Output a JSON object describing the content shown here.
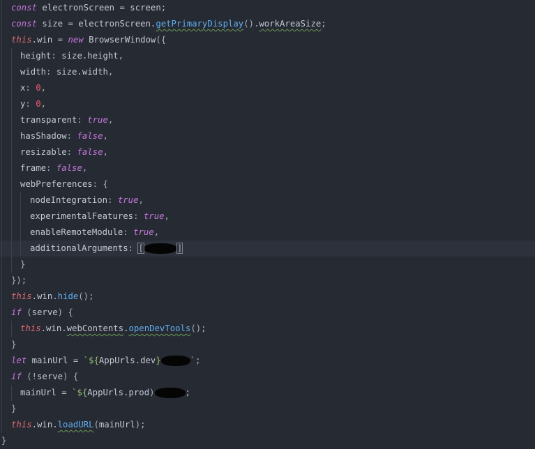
{
  "editor": {
    "lines": [
      {
        "indent": 1,
        "tokens": [
          {
            "t": "const",
            "c": "kw"
          },
          {
            "t": " electronScreen "
          },
          {
            "t": "=",
            "c": "punc"
          },
          {
            "t": " screen"
          },
          {
            "t": ";",
            "c": "punc"
          }
        ]
      },
      {
        "indent": 1,
        "tokens": [
          {
            "t": "const",
            "c": "kw"
          },
          {
            "t": " size "
          },
          {
            "t": "=",
            "c": "punc"
          },
          {
            "t": " electronScreen."
          },
          {
            "t": "getPrimaryDisplay",
            "c": "method",
            "sq": true
          },
          {
            "t": "().",
            "c": "punc"
          },
          {
            "t": "workAreaSize",
            "c": "prop",
            "sq": true
          },
          {
            "t": ";",
            "c": "punc"
          }
        ]
      },
      {
        "indent": 1,
        "tokens": [
          {
            "t": "this",
            "c": "this"
          },
          {
            "t": ".win "
          },
          {
            "t": "=",
            "c": "punc"
          },
          {
            "t": " "
          },
          {
            "t": "new",
            "c": "kw"
          },
          {
            "t": " BrowserWindow"
          },
          {
            "t": "({",
            "c": "punc"
          }
        ]
      },
      {
        "indent": 2,
        "tokens": [
          {
            "t": "height"
          },
          {
            "t": ":",
            "c": "punc"
          },
          {
            "t": " size.height"
          },
          {
            "t": ",",
            "c": "punc"
          }
        ]
      },
      {
        "indent": 2,
        "tokens": [
          {
            "t": "width"
          },
          {
            "t": ":",
            "c": "punc"
          },
          {
            "t": " size.width"
          },
          {
            "t": ",",
            "c": "punc"
          }
        ]
      },
      {
        "indent": 2,
        "tokens": [
          {
            "t": "x"
          },
          {
            "t": ":",
            "c": "punc"
          },
          {
            "t": " "
          },
          {
            "t": "0",
            "c": "num"
          },
          {
            "t": ",",
            "c": "punc"
          }
        ]
      },
      {
        "indent": 2,
        "tokens": [
          {
            "t": "y"
          },
          {
            "t": ":",
            "c": "punc"
          },
          {
            "t": " "
          },
          {
            "t": "0",
            "c": "num"
          },
          {
            "t": ",",
            "c": "punc"
          }
        ]
      },
      {
        "indent": 2,
        "tokens": [
          {
            "t": "transparent"
          },
          {
            "t": ":",
            "c": "punc"
          },
          {
            "t": " "
          },
          {
            "t": "true",
            "c": "kw"
          },
          {
            "t": ",",
            "c": "punc"
          }
        ]
      },
      {
        "indent": 2,
        "tokens": [
          {
            "t": "hasShadow"
          },
          {
            "t": ":",
            "c": "punc"
          },
          {
            "t": " "
          },
          {
            "t": "false",
            "c": "kw"
          },
          {
            "t": ",",
            "c": "punc"
          }
        ]
      },
      {
        "indent": 2,
        "tokens": [
          {
            "t": "resizable"
          },
          {
            "t": ":",
            "c": "punc"
          },
          {
            "t": " "
          },
          {
            "t": "false",
            "c": "kw"
          },
          {
            "t": ",",
            "c": "punc"
          }
        ]
      },
      {
        "indent": 2,
        "tokens": [
          {
            "t": "frame"
          },
          {
            "t": ":",
            "c": "punc"
          },
          {
            "t": " "
          },
          {
            "t": "false",
            "c": "kw"
          },
          {
            "t": ",",
            "c": "punc"
          }
        ]
      },
      {
        "indent": 2,
        "tokens": [
          {
            "t": "webPreferences"
          },
          {
            "t": ":",
            "c": "punc"
          },
          {
            "t": " {",
            "c": "punc"
          }
        ]
      },
      {
        "indent": 3,
        "tokens": [
          {
            "t": "nodeIntegration"
          },
          {
            "t": ":",
            "c": "punc"
          },
          {
            "t": " "
          },
          {
            "t": "true",
            "c": "kw"
          },
          {
            "t": ",",
            "c": "punc"
          }
        ]
      },
      {
        "indent": 3,
        "tokens": [
          {
            "t": "experimentalFeatures"
          },
          {
            "t": ":",
            "c": "punc"
          },
          {
            "t": " "
          },
          {
            "t": "true",
            "c": "kw"
          },
          {
            "t": ",",
            "c": "punc"
          }
        ]
      },
      {
        "indent": 3,
        "tokens": [
          {
            "t": "enableRemoteModule"
          },
          {
            "t": ":",
            "c": "punc"
          },
          {
            "t": " "
          },
          {
            "t": "true",
            "c": "kw"
          },
          {
            "t": ",",
            "c": "punc"
          }
        ]
      },
      {
        "indent": 3,
        "current": true,
        "tokens": [
          {
            "t": "additionalArguments"
          },
          {
            "t": ":",
            "c": "punc"
          },
          {
            "t": " "
          },
          {
            "t": "[",
            "c": "punc",
            "match": true
          },
          {
            "redact": 48
          },
          {
            "t": "]",
            "c": "punc",
            "match": true
          }
        ]
      },
      {
        "indent": 2,
        "tokens": [
          {
            "t": "}",
            "c": "punc"
          }
        ]
      },
      {
        "indent": 1,
        "tokens": [
          {
            "t": "});",
            "c": "punc"
          }
        ]
      },
      {
        "indent": 1,
        "tokens": [
          {
            "t": "this",
            "c": "this"
          },
          {
            "t": ".win."
          },
          {
            "t": "hide",
            "c": "method"
          },
          {
            "t": "();",
            "c": "punc"
          }
        ]
      },
      {
        "indent": 1,
        "tokens": [
          {
            "t": "if",
            "c": "kw"
          },
          {
            "t": " "
          },
          {
            "t": "(",
            "c": "punc"
          },
          {
            "t": "serve"
          },
          {
            "t": ") {",
            "c": "punc"
          }
        ]
      },
      {
        "indent": 2,
        "tokens": [
          {
            "t": "this",
            "c": "this"
          },
          {
            "t": ".win."
          },
          {
            "t": "webContents",
            "c": "prop",
            "sq": true
          },
          {
            "t": "."
          },
          {
            "t": "openDevTools",
            "c": "method",
            "sq": true
          },
          {
            "t": "();",
            "c": "punc"
          }
        ]
      },
      {
        "indent": 1,
        "tokens": [
          {
            "t": "}",
            "c": "punc"
          }
        ]
      },
      {
        "indent": 1,
        "tokens": [
          {
            "t": "let",
            "c": "kw"
          },
          {
            "t": " mainUrl "
          },
          {
            "t": "=",
            "c": "punc"
          },
          {
            "t": " `${",
            "c": "str"
          },
          {
            "t": "AppUrls.dev",
            "c": "interp"
          },
          {
            "t": "}",
            "c": "str"
          },
          {
            "redact": 42
          },
          {
            "t": "`",
            "c": "str"
          },
          {
            "t": ";",
            "c": "punc"
          }
        ]
      },
      {
        "indent": 1,
        "tokens": [
          {
            "t": "if",
            "c": "kw"
          },
          {
            "t": " "
          },
          {
            "t": "(!",
            "c": "punc"
          },
          {
            "t": "serve"
          },
          {
            "t": ") {",
            "c": "punc"
          }
        ]
      },
      {
        "indent": 2,
        "tokens": [
          {
            "t": "mainUrl "
          },
          {
            "t": "=",
            "c": "punc"
          },
          {
            "t": " `${",
            "c": "str"
          },
          {
            "t": "AppUrls.prod",
            "c": "interp"
          },
          {
            "t": ")",
            "c": "punc"
          },
          {
            "redact": 44
          },
          {
            "t": ";",
            "c": "punc"
          }
        ]
      },
      {
        "indent": 1,
        "tokens": [
          {
            "t": "}",
            "c": "punc"
          }
        ]
      },
      {
        "indent": 1,
        "tokens": [
          {
            "t": "this",
            "c": "this"
          },
          {
            "t": ".win."
          },
          {
            "t": "loadURL",
            "c": "method",
            "sq": true
          },
          {
            "t": "(",
            "c": "punc"
          },
          {
            "t": "mainUrl"
          },
          {
            "t": ");",
            "c": "punc"
          }
        ]
      },
      {
        "indent": 0,
        "tokens": [
          {
            "t": "}",
            "c": "punc"
          }
        ]
      }
    ]
  }
}
